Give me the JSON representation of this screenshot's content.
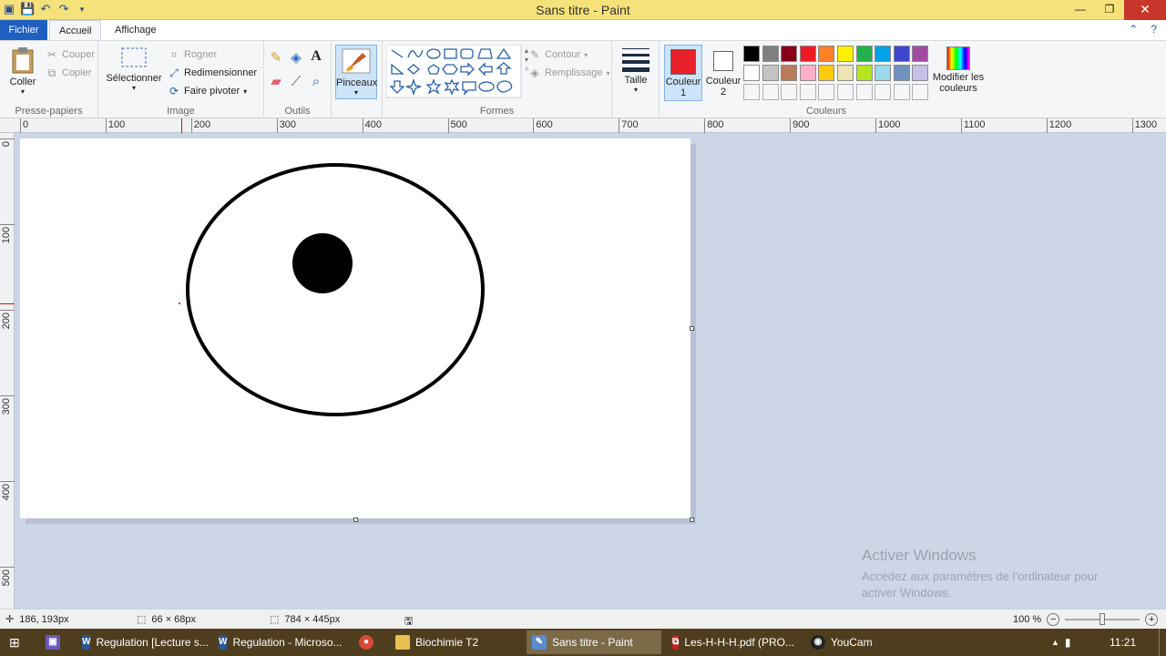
{
  "window": {
    "title": "Sans titre - Paint"
  },
  "tabs": {
    "file": "Fichier",
    "home": "Accueil",
    "view": "Affichage"
  },
  "clipboard": {
    "paste": "Coller",
    "cut": "Couper",
    "copy": "Copier",
    "label": "Presse-papiers"
  },
  "image": {
    "select": "Sélectionner",
    "crop": "Rogner",
    "resize": "Redimensionner",
    "rotate": "Faire pivoter",
    "label": "Image"
  },
  "tools": {
    "label": "Outils"
  },
  "brushes": {
    "label": "Pinceaux"
  },
  "shapes": {
    "outline": "Contour",
    "fill": "Remplissage",
    "label": "Formes"
  },
  "size": {
    "label": "Taille"
  },
  "colors": {
    "color1": "Couleur 1",
    "color2": "Couleur 2",
    "edit": "Modifier les couleurs",
    "label": "Couleurs",
    "color1_value": "#e8202a",
    "color2_value": "#ffffff",
    "palette_row1": [
      "#000000",
      "#7f7f7f",
      "#880015",
      "#ed1c24",
      "#ff7f27",
      "#fff200",
      "#22b14c",
      "#00a2e8",
      "#3f48cc",
      "#a349a4"
    ],
    "palette_row2": [
      "#ffffff",
      "#c3c3c3",
      "#b97a57",
      "#ffaec9",
      "#ffc90e",
      "#efe4b0",
      "#b5e61d",
      "#99d9ea",
      "#7092be",
      "#c8bfe7"
    ]
  },
  "ruler_h": [
    "0",
    "100",
    "200",
    "300",
    "400",
    "500",
    "600",
    "700",
    "800",
    "900",
    "1000",
    "1100",
    "1200",
    "1300"
  ],
  "ruler_v": [
    "0",
    "100",
    "200",
    "300",
    "400",
    "500"
  ],
  "status": {
    "cursor": "186, 193px",
    "selection": "66 × 68px",
    "canvas_size": "784 × 445px",
    "zoom": "100 %"
  },
  "watermark": {
    "heading": "Activer Windows",
    "line1": "Accédez aux paramètres de l’ordinateur pour",
    "line2": "activer Windows."
  },
  "taskbar": {
    "items": [
      "Regulation [Lecture s...",
      "Regulation - Microso...",
      "Biochimie T2",
      "Sans titre - Paint",
      "Les-H-H-H.pdf (PRO...",
      "YouCam"
    ],
    "time": "11:21"
  }
}
